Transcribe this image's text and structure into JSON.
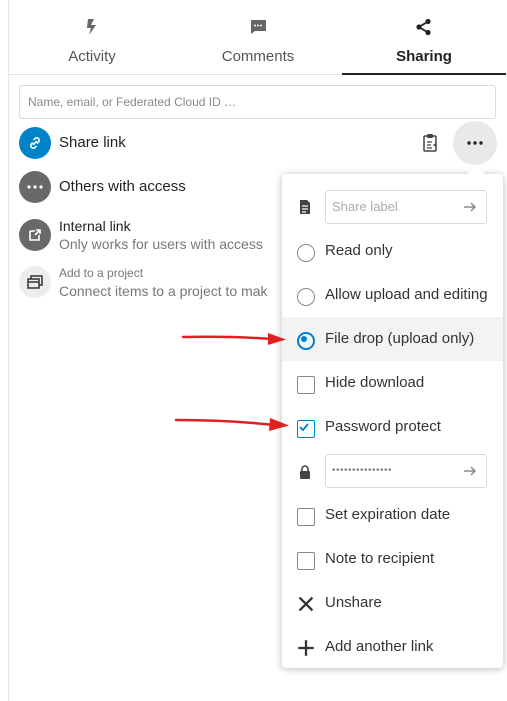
{
  "tabs": [
    {
      "label": "Activity",
      "icon": "activity-icon"
    },
    {
      "label": "Comments",
      "icon": "comment-icon"
    },
    {
      "label": "Sharing",
      "icon": "share-icon",
      "active": true
    }
  ],
  "search": {
    "placeholder": "Name, email, or Federated Cloud ID …"
  },
  "shares": {
    "share_link": "Share link",
    "others_with_access": "Others with access",
    "internal_link": {
      "title": "Internal link",
      "subtitle": "Only works for users with access"
    },
    "project": {
      "title": "Add to a project",
      "subtitle": "Connect items to a project to mak"
    }
  },
  "menu": {
    "share_label_placeholder": "Share label",
    "read_only": "Read only",
    "allow_upload": "Allow upload and editing",
    "file_drop": "File drop (upload only)",
    "hide_download": "Hide download",
    "password_protect": "Password protect",
    "password_value": "•••••••••••••••",
    "set_expiration": "Set expiration date",
    "note_to_recipient": "Note to recipient",
    "unshare": "Unshare",
    "add_another_link": "Add another link"
  },
  "state": {
    "selected_permission": "file_drop",
    "password_protect_checked": true,
    "hide_download_checked": false,
    "expiration_checked": false,
    "note_checked": false
  },
  "colors": {
    "accent": "#0082c9",
    "annotation_arrow": "#e02020",
    "avatar_grey": "#696969"
  }
}
